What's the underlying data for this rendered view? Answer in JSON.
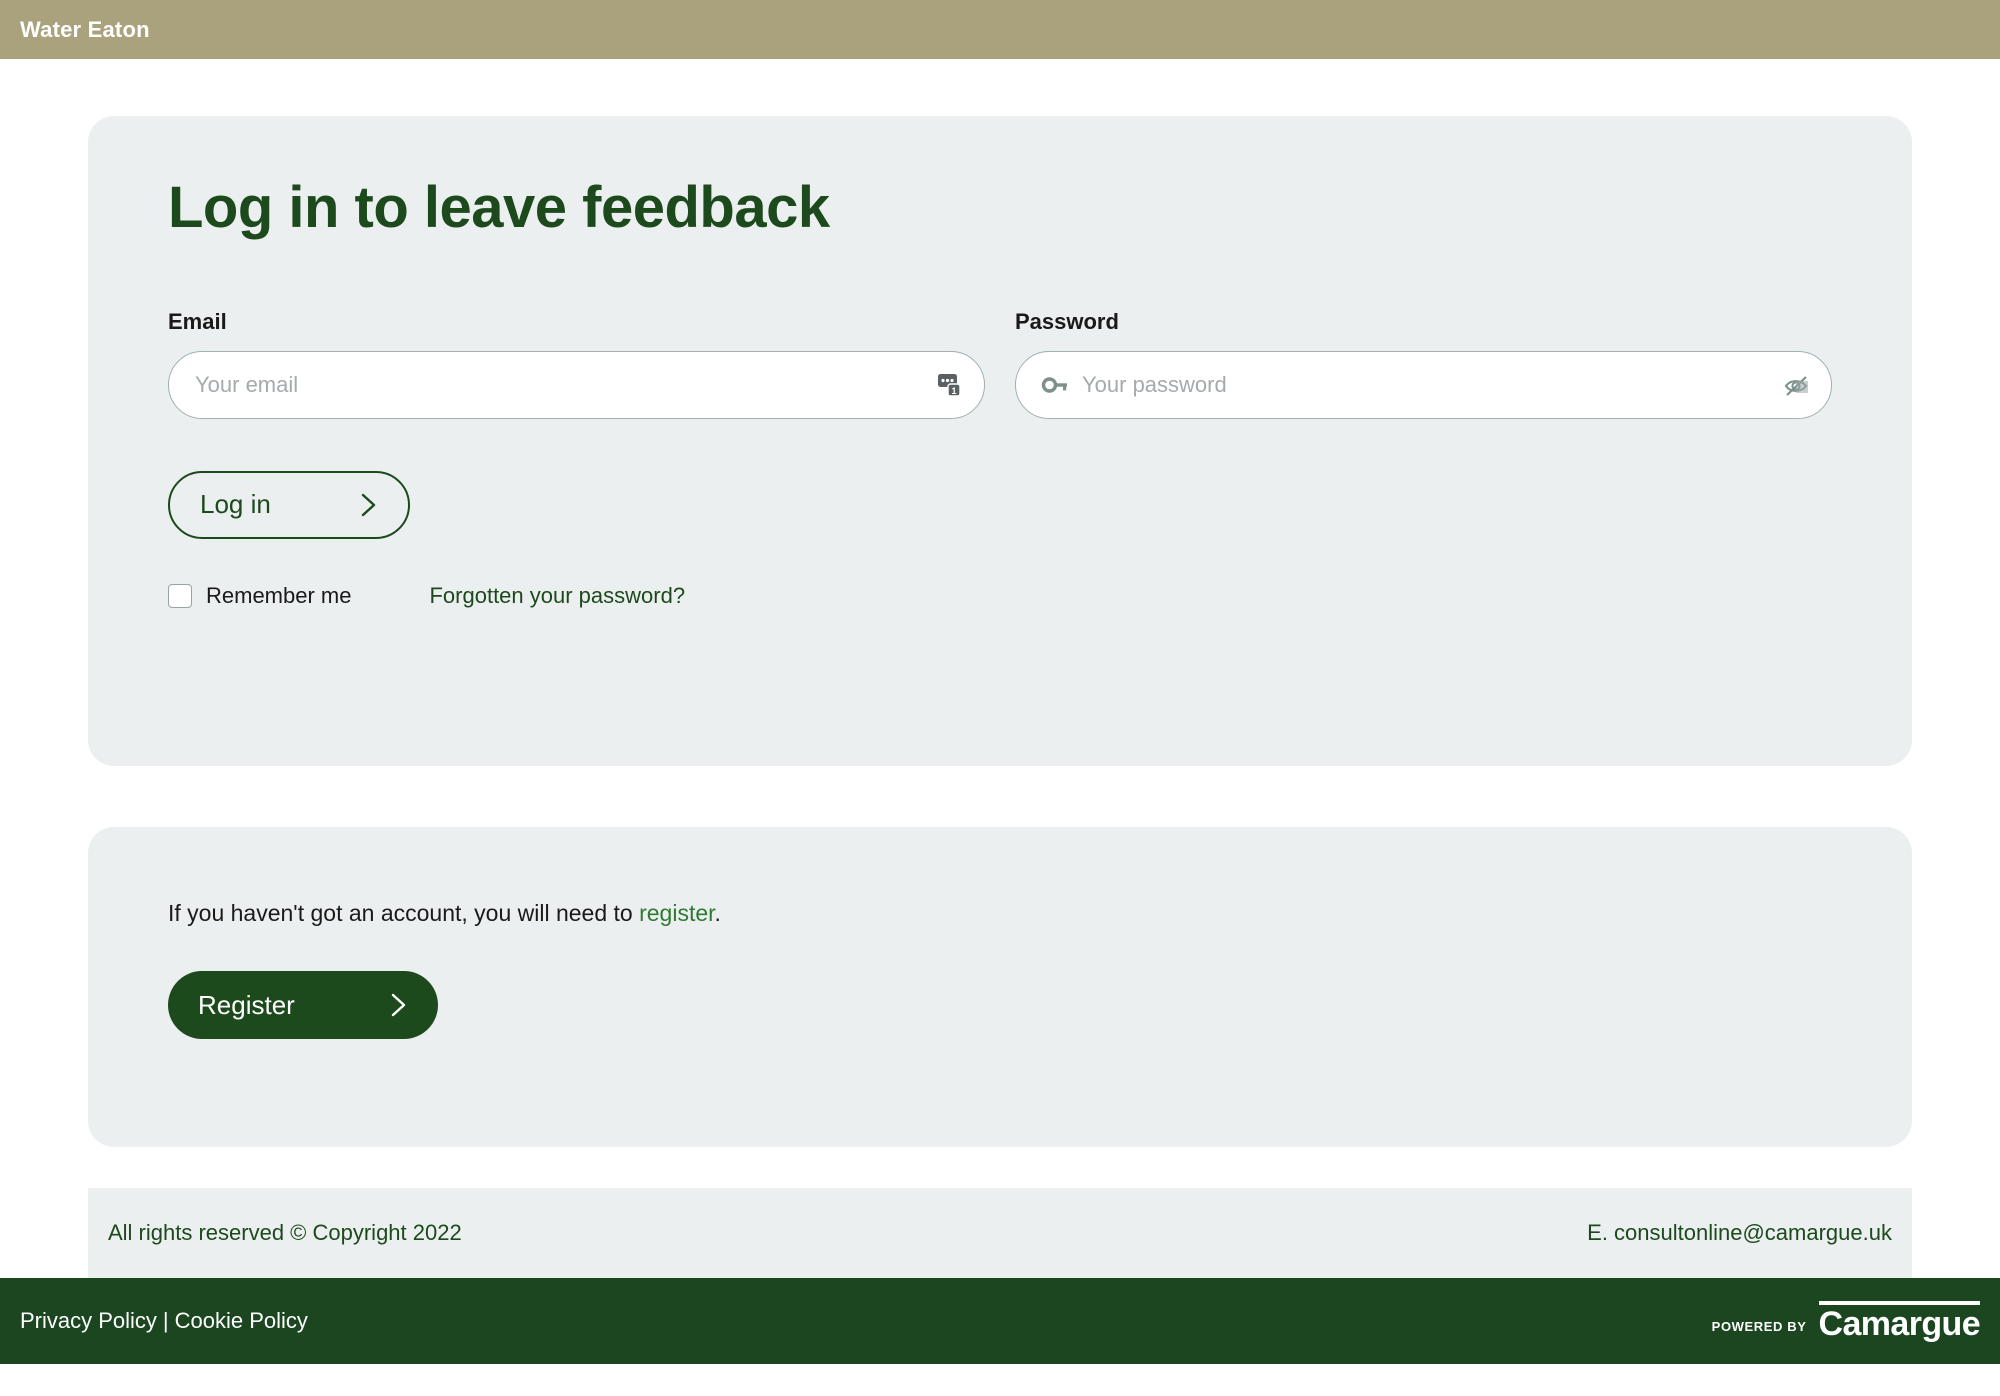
{
  "topbar": {
    "title": "Water Eaton",
    "bg_color": "#a9a27d"
  },
  "login_card": {
    "heading": "Log in to leave feedback",
    "email": {
      "label": "Email",
      "placeholder": "Your email",
      "value": "",
      "autofill_icon": "form-autofill-icon"
    },
    "password": {
      "label": "Password",
      "placeholder": "Your password",
      "value": "",
      "key_icon": "key-icon",
      "reveal_icon": "eye-hidden-icon"
    },
    "login_button": "Log in",
    "remember_label": "Remember me",
    "remember_checked": false,
    "forgot_link": "Forgotten your password?"
  },
  "register_card": {
    "text_before": "If you haven't got an account, you will need to ",
    "link": "register",
    "text_after": ".",
    "register_button": "Register"
  },
  "footer": {
    "copyright": "All rights reserved © Copyright 2022",
    "email": "E. consultonline@camargue.uk",
    "privacy_policy": "Privacy Policy",
    "separator": "|",
    "cookie_policy": "Cookie Policy",
    "powered_by": "POWERED BY",
    "brand": "Camargue"
  },
  "colors": {
    "brand_green": "#1d4a1d",
    "dark_green_bar": "#1b4620",
    "card_bg": "#eceff0",
    "khaki": "#a9a27d",
    "link_green": "#2f7a33"
  }
}
